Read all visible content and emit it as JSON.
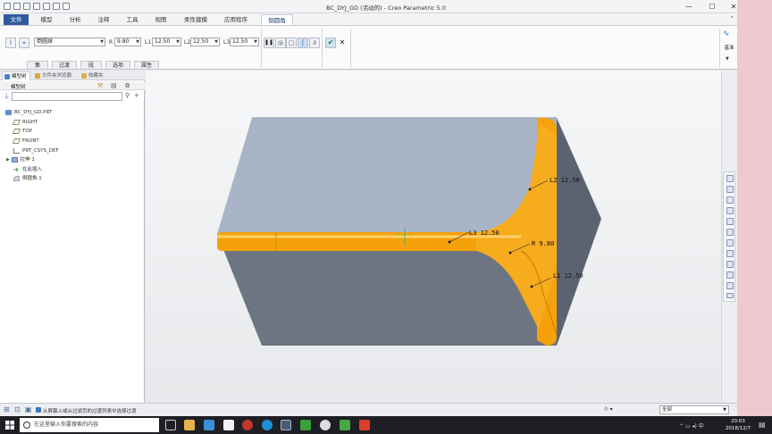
{
  "window": {
    "title": "BC_DYJ_GD (活动的) - Creo Parametric 5.0",
    "min_glyph": "—",
    "max_glyph": "☐",
    "close_glyph": "✕"
  },
  "ribbon_tabs": [
    "文件",
    "模型",
    "分析",
    "注释",
    "工具",
    "视图",
    "柔性建模",
    "应用程序",
    "倒圆角"
  ],
  "ribbon": {
    "shape_dropdown": "倒圆球",
    "r_label": "R",
    "r_value": "9.80",
    "l1_label": "L1",
    "l1_value": "12.50",
    "l2_label": "L2",
    "l2_value": "12.50",
    "l3_label": "L3",
    "l3_value": "12.50",
    "pause_glyph": "❚❚",
    "confirm_glyph": "✔",
    "cancel_glyph": "✕",
    "base_label": "基准",
    "subtabs": [
      "集",
      "过渡",
      "段",
      "选项",
      "属性"
    ]
  },
  "left_panel": {
    "tabs": [
      "模型树",
      "文件夹浏览器",
      "收藏夹"
    ],
    "header": "模型树",
    "tree": [
      {
        "label": "BC_DYJ_GD.PRT",
        "icon": "part-icon"
      },
      {
        "label": "RIGHT",
        "icon": "datum-plane-icon"
      },
      {
        "label": "TOP",
        "icon": "datum-plane-icon"
      },
      {
        "label": "FRONT",
        "icon": "datum-plane-icon"
      },
      {
        "label": "PRT_CSYS_DEF",
        "icon": "csys-icon"
      },
      {
        "label": "拉伸 1",
        "icon": "extrude-icon"
      },
      {
        "label": "在此插入",
        "icon": "insert-here-icon"
      },
      {
        "label": "倒圆角 1",
        "icon": "round-icon"
      }
    ]
  },
  "viewport": {
    "dim_l1": "L1 12.50",
    "dim_l2": "L2 12.50",
    "dim_l3": "L3 12.50",
    "dim_r": "R 9.80",
    "colors": {
      "face_top": "#a9b5c6",
      "face_front": "#6e7582",
      "face_side": "#5c6370",
      "round": "#f5a10a"
    }
  },
  "status": {
    "message": "从屏幕上或从过滤页的过渡列表中选择过渡",
    "filter": "全部"
  },
  "taskbar": {
    "search_placeholder": "在这里输入你要搜索的内容",
    "time": "20:03",
    "date": "2018/12/7"
  }
}
